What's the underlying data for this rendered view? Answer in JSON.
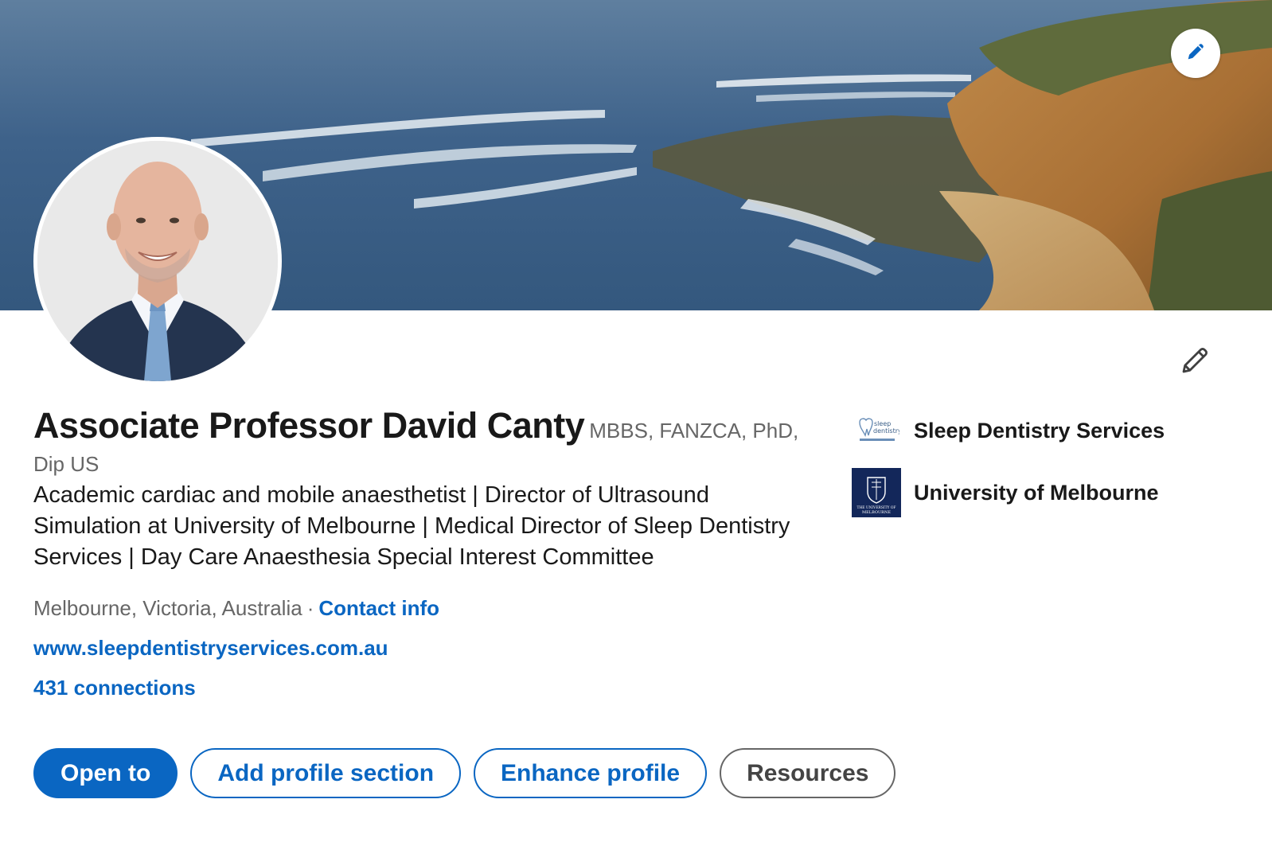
{
  "profile": {
    "name": "Associate Professor David Canty",
    "credentials_line1": "MBBS, FANZCA, PhD,",
    "credentials_line2": "Dip US",
    "headline": "Academic cardiac and mobile anaesthetist | Director of Ultrasound Simulation at University of Melbourne | Medical Director of Sleep Dentistry Services | Day Care Anaesthesia Special Interest Committee",
    "location": "Melbourne, Victoria, Australia",
    "separator": "·",
    "contact_info_label": "Contact info",
    "website": "www.sleepdentistryservices.com.au",
    "connections": "431 connections"
  },
  "organizations": [
    {
      "name": "Sleep Dentistry Services",
      "logo": "sleep-dentistry-logo",
      "logo_text_1": "sleep",
      "logo_text_2": "dentistry"
    },
    {
      "name": "University of Melbourne",
      "logo": "university-of-melbourne-logo",
      "logo_text_1": "THE UNIVERSITY OF",
      "logo_text_2": "MELBOURNE"
    }
  ],
  "actions": {
    "open_to": "Open to",
    "add_section": "Add profile section",
    "enhance": "Enhance profile",
    "resources": "Resources"
  },
  "icons": {
    "cover_edit": "pencil-icon",
    "intro_edit": "pencil-icon"
  },
  "colors": {
    "accent": "#0a66c2",
    "text": "#191919",
    "muted": "#666666"
  }
}
